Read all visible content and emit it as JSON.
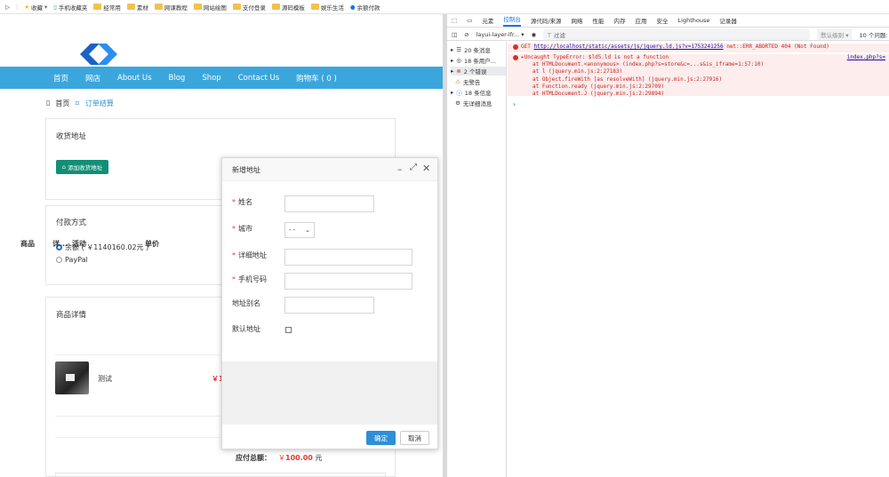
{
  "bookmarks": {
    "items": [
      {
        "label": "收藏",
        "icon": "star-icon"
      },
      {
        "label": "手机收藏夹",
        "icon": "phone-icon"
      },
      {
        "label": "经常用",
        "icon": "folder-icon"
      },
      {
        "label": "素材",
        "icon": "folder-icon"
      },
      {
        "label": "网课教程",
        "icon": "folder-icon"
      },
      {
        "label": "网站绘图",
        "icon": "folder-icon"
      },
      {
        "label": "支付登录",
        "icon": "folder-icon"
      },
      {
        "label": "源码模板",
        "icon": "folder-icon"
      },
      {
        "label": "娱乐生活",
        "icon": "folder-icon"
      },
      {
        "label": "余额付款",
        "icon": "drop-icon"
      }
    ]
  },
  "nav": {
    "items": [
      "首页",
      "网店",
      "About Us",
      "Blog",
      "Shop",
      "Contact Us",
      "购物车 ( 0 )"
    ]
  },
  "breadcrumb": {
    "home": "首页",
    "current": "订单结算"
  },
  "address_panel": {
    "title": "收货地址",
    "add_button": "添加收货地址"
  },
  "payment_panel": {
    "title": "付款方式",
    "options": [
      {
        "label": "余额 ( ￥1140160.02元 )",
        "checked": true
      },
      {
        "label": "PayPal",
        "checked": false
      }
    ]
  },
  "goods_panel": {
    "title": "商品详情",
    "headers": [
      "商品",
      "详...",
      "活动",
      "单价"
    ],
    "row": {
      "name": "测试",
      "price_partial": "￥1"
    }
  },
  "total": {
    "label": "应付总额：",
    "currency": "￥",
    "amount": "100.00",
    "unit": "元"
  },
  "modal": {
    "title": "新增地址",
    "fields": [
      {
        "label": "姓名",
        "required": true
      },
      {
        "label": "城市",
        "required": true,
        "select_value": "- -"
      },
      {
        "label": "详细地址",
        "required": true
      },
      {
        "label": "手机号码",
        "required": true
      },
      {
        "label": "地址别名",
        "required": false
      },
      {
        "label": "默认地址",
        "required": false
      }
    ],
    "ok": "确定",
    "cancel": "取消"
  },
  "devtools": {
    "tabs": [
      "元素",
      "控制台",
      "源代码/来源",
      "网络",
      "性能",
      "内存",
      "应用",
      "安全",
      "Lighthouse",
      "记录器"
    ],
    "active_tab": "控制台",
    "context": "layui-layer-ifr...",
    "filter_placeholder": "过滤",
    "level": "默认级别",
    "issues": "10 个问题:",
    "sidebar": [
      {
        "label": "20 条消息",
        "icon": "list-icon"
      },
      {
        "label": "18 条用户...",
        "icon": "user-icon"
      },
      {
        "label": "2 个错误",
        "icon": "error-icon"
      },
      {
        "label": "无警告",
        "icon": "warning-icon"
      },
      {
        "label": "18 条信息",
        "icon": "info-icon"
      },
      {
        "label": "无详细消息",
        "icon": "bug-icon"
      }
    ],
    "errors": {
      "e1": {
        "prefix": "GET ",
        "url": "http://localhost/static/assets/js/jquery.ld.js?v=1753241256",
        "msg": " net::ERR_ABORTED 404 (Not Found)"
      },
      "e2": {
        "head": "▸Uncaught TypeError: $ld5.ld is not a function",
        "link": "index.php?s=",
        "lines": [
          "at HTMLDocument.<anonymous> (index.php?s=store&c=...s&is_iframe=1:57:10)",
          "at l (jquery.min.js:2:27183)",
          "at Object.fireWith [as resolveWith] (jquery.min.js:2:27916)",
          "at Function.ready (jquery.min.js:2:29709)",
          "at HTMLDocument.J (jquery.min.js:2:29894)"
        ]
      }
    },
    "prompt": "›"
  },
  "colors": {
    "nav": "#3ba6dc",
    "green": "#128f76",
    "primary": "#2f8ed8",
    "error": "#d93025"
  }
}
